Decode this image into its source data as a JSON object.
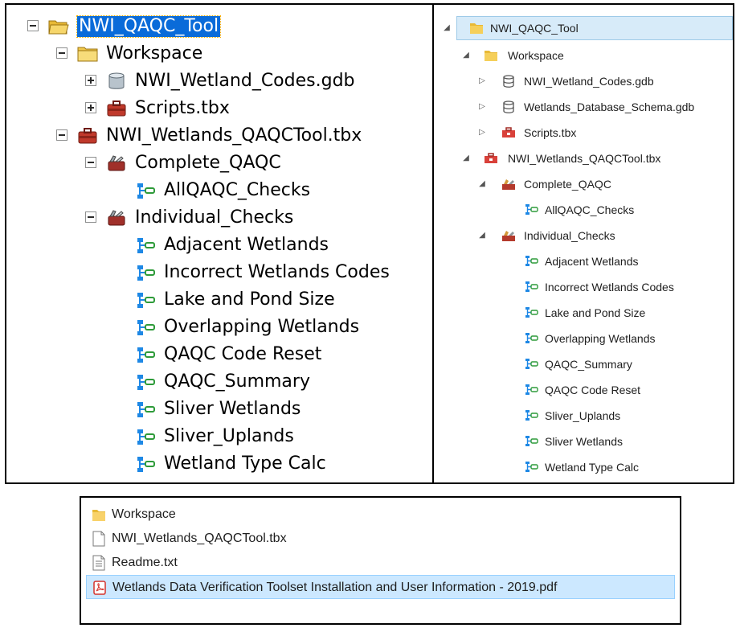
{
  "left_tree": {
    "items": [
      {
        "label": "NWI_QAQC_Tool",
        "icon": "folder-open-icon",
        "expander": "minus",
        "selected": true
      },
      {
        "label": "Workspace",
        "icon": "folder-icon",
        "expander": "minus"
      },
      {
        "label": "NWI_Wetland_Codes.gdb",
        "icon": "geodatabase-icon",
        "expander": "plus"
      },
      {
        "label": "Scripts.tbx",
        "icon": "toolbox-icon",
        "expander": "plus"
      },
      {
        "label": "NWI_Wetlands_QAQCTool.tbx",
        "icon": "toolbox-icon",
        "expander": "minus"
      },
      {
        "label": "Complete_QAQC",
        "icon": "toolset-icon",
        "expander": "minus"
      },
      {
        "label": "AllQAQC_Checks",
        "icon": "model-tool-icon"
      },
      {
        "label": "Individual_Checks",
        "icon": "toolset-icon",
        "expander": "minus"
      },
      {
        "label": "Adjacent Wetlands",
        "icon": "model-tool-icon"
      },
      {
        "label": "Incorrect Wetlands Codes",
        "icon": "model-tool-icon"
      },
      {
        "label": "Lake and Pond Size",
        "icon": "model-tool-icon"
      },
      {
        "label": "Overlapping Wetlands",
        "icon": "model-tool-icon"
      },
      {
        "label": "QAQC Code Reset",
        "icon": "model-tool-icon"
      },
      {
        "label": "QAQC_Summary",
        "icon": "model-tool-icon"
      },
      {
        "label": "Sliver Wetlands",
        "icon": "model-tool-icon"
      },
      {
        "label": "Sliver_Uplands",
        "icon": "model-tool-icon"
      },
      {
        "label": "Wetland Type Calc",
        "icon": "model-tool-icon"
      }
    ]
  },
  "right_tree": {
    "items": [
      {
        "label": "NWI_QAQC_Tool",
        "icon": "folder-icon",
        "expander": "expanded",
        "selected": true
      },
      {
        "label": "Workspace",
        "icon": "folder-icon",
        "expander": "expanded"
      },
      {
        "label": "NWI_Wetland_Codes.gdb",
        "icon": "database-icon",
        "expander": "collapsed"
      },
      {
        "label": "Wetlands_Database_Schema.gdb",
        "icon": "database-icon",
        "expander": "collapsed"
      },
      {
        "label": "Scripts.tbx",
        "icon": "toolbox-icon",
        "expander": "collapsed"
      },
      {
        "label": "NWI_Wetlands_QAQCTool.tbx",
        "icon": "toolbox-icon",
        "expander": "expanded"
      },
      {
        "label": "Complete_QAQC",
        "icon": "toolset-icon",
        "expander": "expanded"
      },
      {
        "label": "AllQAQC_Checks",
        "icon": "model-tool-icon"
      },
      {
        "label": "Individual_Checks",
        "icon": "toolset-icon",
        "expander": "expanded"
      },
      {
        "label": "Adjacent Wetlands",
        "icon": "model-tool-icon"
      },
      {
        "label": "Incorrect Wetlands Codes",
        "icon": "model-tool-icon"
      },
      {
        "label": "Lake and Pond Size",
        "icon": "model-tool-icon"
      },
      {
        "label": "Overlapping Wetlands",
        "icon": "model-tool-icon"
      },
      {
        "label": "QAQC_Summary",
        "icon": "model-tool-icon"
      },
      {
        "label": "QAQC Code Reset",
        "icon": "model-tool-icon"
      },
      {
        "label": "Sliver_Uplands",
        "icon": "model-tool-icon"
      },
      {
        "label": "Sliver Wetlands",
        "icon": "model-tool-icon"
      },
      {
        "label": "Wetland Type Calc",
        "icon": "model-tool-icon"
      }
    ]
  },
  "file_list": {
    "items": [
      {
        "label": "Workspace",
        "icon": "folder-icon"
      },
      {
        "label": "NWI_Wetlands_QAQCTool.tbx",
        "icon": "file-icon"
      },
      {
        "label": "Readme.txt",
        "icon": "text-file-icon"
      },
      {
        "label": "Wetlands Data Verification Toolset Installation and User Information - 2019.pdf",
        "icon": "pdf-icon",
        "selected": true
      }
    ]
  },
  "colors": {
    "left_selection": "#0a6bd9",
    "right_selection": "#d7ebf9",
    "bottom_selection": "#cce8ff",
    "folder": "#f2c94c",
    "toolbox": "#c0392b",
    "tool_link": "#1e88e5",
    "tool_node": "#2e9b3a"
  }
}
